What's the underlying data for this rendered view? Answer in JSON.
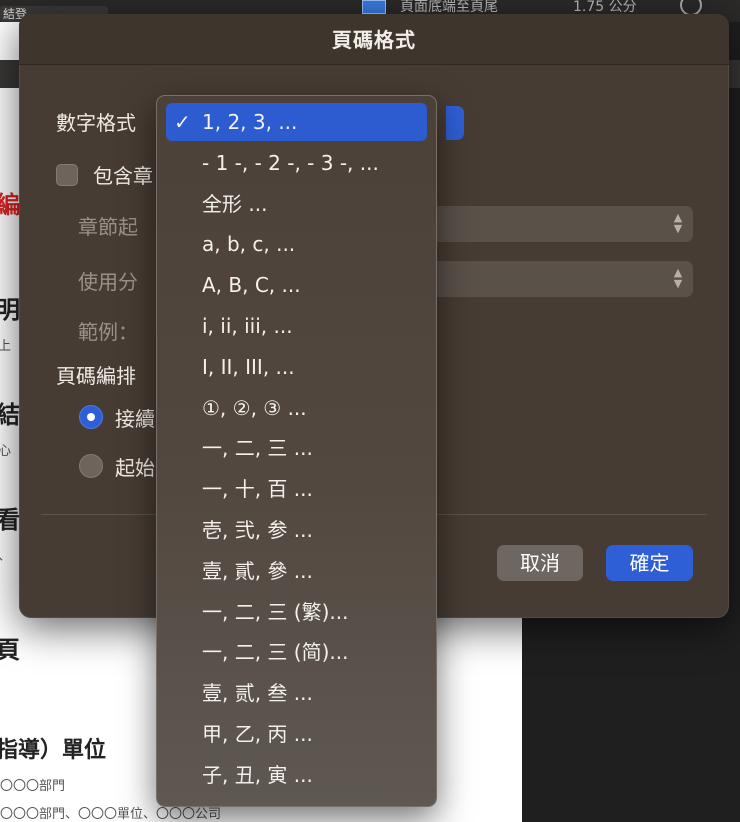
{
  "background": {
    "topbar": {
      "chip_text": "結登",
      "text_a": "頁面底端至頁尾",
      "text_b": "1.75 公分"
    },
    "doc_fragments": [
      "編",
      "明",
      "上",
      "結",
      "心",
      "看",
      "、",
      "頁",
      "指導）單位",
      "〇〇〇部門",
      "〇〇〇部門、〇〇〇單位、〇〇〇公司"
    ]
  },
  "dialog": {
    "title": "頁碼格式",
    "number_format_label": "數字格式",
    "include_chapter_label": "包含章",
    "chapter_start_label": "章節起",
    "use_separator_label": "使用分",
    "example_label": "範例：",
    "page_numbering_label": "頁碼編排",
    "continue_label": "接續",
    "start_at_label": "起始",
    "cancel_label": "取消",
    "ok_label": "確定"
  },
  "menu": {
    "selected_index": 0,
    "check_glyph": "✓",
    "items": [
      "1, 2, 3, ...",
      "- 1 -, - 2 -, - 3 -, ...",
      "全形 ...",
      "a, b, c, ...",
      "A, B, C, ...",
      "i, ii, iii, ...",
      "I, II, III, ...",
      "①, ②, ③ ...",
      "一, 二, 三 ...",
      "一, 十, 百 ...",
      "壱, 弐, 参 ...",
      "壹, 貳, 參 ...",
      "一, 二, 三 (繁)...",
      "一, 二, 三 (简)...",
      "壹, 贰, 叁 ...",
      "甲, 乙, 丙 ...",
      "子, 丑, 寅 ..."
    ]
  },
  "colors": {
    "dialog_bg": "#463c33",
    "accent": "#2f5fd6",
    "cancel_button": "#6e6660"
  }
}
